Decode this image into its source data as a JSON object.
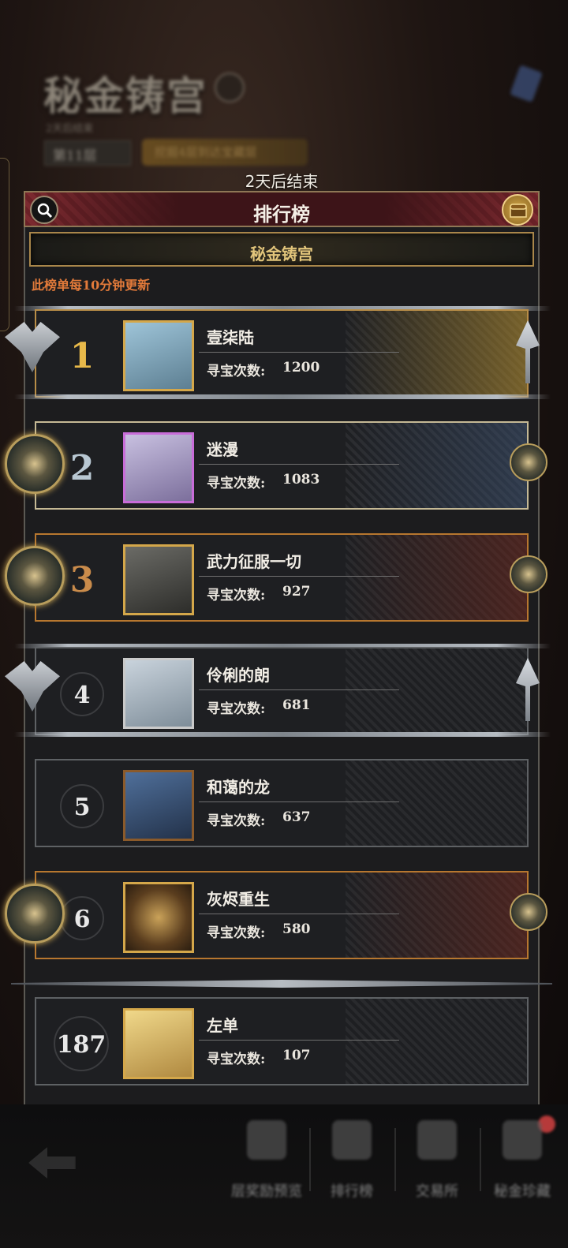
{
  "background": {
    "title": "秘金铸宫",
    "subtitle": "2天后结束",
    "floor_label": "第11层",
    "pill_text": "挖掘4层到达宝藏层"
  },
  "end_notice": "2天后结束",
  "panel": {
    "title": "排行榜",
    "subtitle": "秘金铸宫",
    "update_note": "此榜单每10分钟更新"
  },
  "count_label": "寻宝次数:",
  "ranking": [
    {
      "rank": "1",
      "name": "壹柒陆",
      "count": "1200"
    },
    {
      "rank": "2",
      "name": "迷漫",
      "count": "1083"
    },
    {
      "rank": "3",
      "name": "武力征服一切",
      "count": "927"
    },
    {
      "rank": "4",
      "name": "伶俐的朗",
      "count": "681"
    },
    {
      "rank": "5",
      "name": "和蔼的龙",
      "count": "637"
    },
    {
      "rank": "6",
      "name": "灰烬重生",
      "count": "580"
    }
  ],
  "my_entry": {
    "rank": "187",
    "name": "左单",
    "count": "107"
  },
  "bottom_nav": [
    "层奖励预览",
    "排行榜",
    "交易所",
    "秘金珍藏"
  ],
  "colors": {
    "accent_gold": "#e2c57b",
    "note_orange": "#e27a3a",
    "header_red": "#7d2a30"
  }
}
